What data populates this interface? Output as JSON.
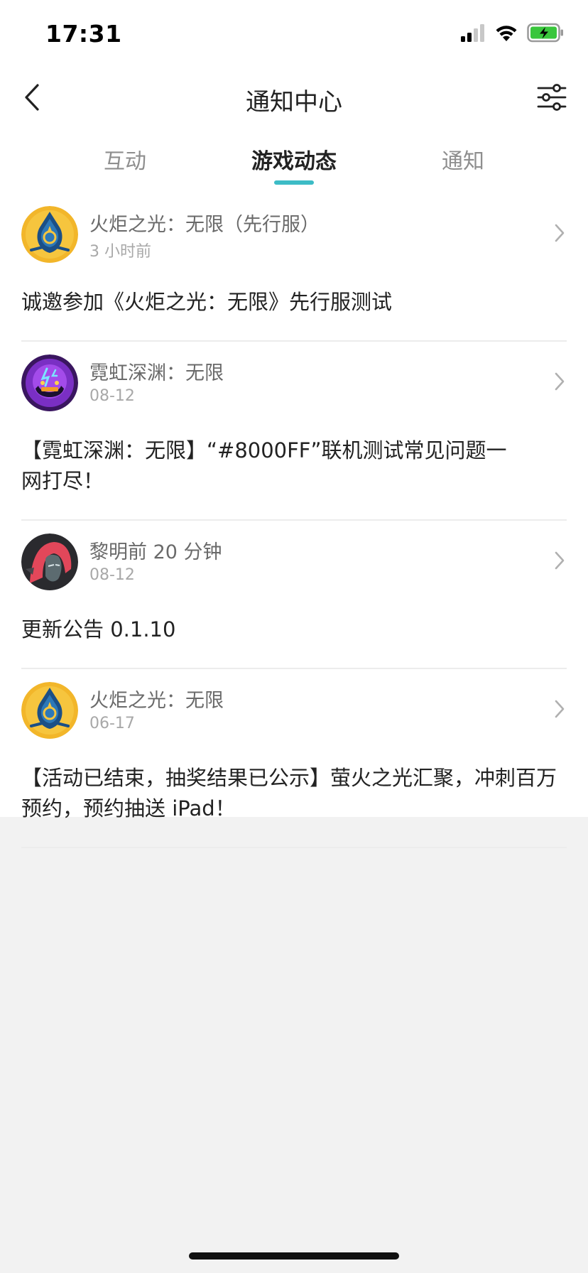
{
  "status_bar": {
    "time": "17:31",
    "icons": [
      "cellular-signal-icon",
      "wifi-icon",
      "battery-charging-icon"
    ]
  },
  "header": {
    "title": "通知中心",
    "back_icon": "chevron-left-icon",
    "filter_icon": "filter-sliders-icon"
  },
  "tabs": [
    {
      "label": "互动",
      "active": false
    },
    {
      "label": "游戏动态",
      "active": true
    },
    {
      "label": "通知",
      "active": false
    }
  ],
  "colors": {
    "accent": "#3dbcc6",
    "divider": "#ececec",
    "background": "#f2f2f2"
  },
  "feed": [
    {
      "avatar_icon": "torchlight-logo-icon",
      "name": "火炬之光：无限（先行服）",
      "time": "3 小时前",
      "text": "诚邀参加《火炬之光：无限》先行服测试"
    },
    {
      "avatar_icon": "neon-abyss-logo-icon",
      "name": "霓虹深渊：无限",
      "time": "08-12",
      "text": "【霓虹深渊：无限】“#8000FF”联机测试常见问题一网打尽！"
    },
    {
      "avatar_icon": "red-hair-character-icon",
      "name": "黎明前 20 分钟",
      "time": "08-12",
      "text": "更新公告 0.1.10"
    },
    {
      "avatar_icon": "torchlight-logo-icon",
      "name": "火炬之光：无限",
      "time": "06-17",
      "text": "【活动已结束，抽奖结果已公示】萤火之光汇聚，冲刺百万预约，预约抽送 iPad！"
    }
  ]
}
